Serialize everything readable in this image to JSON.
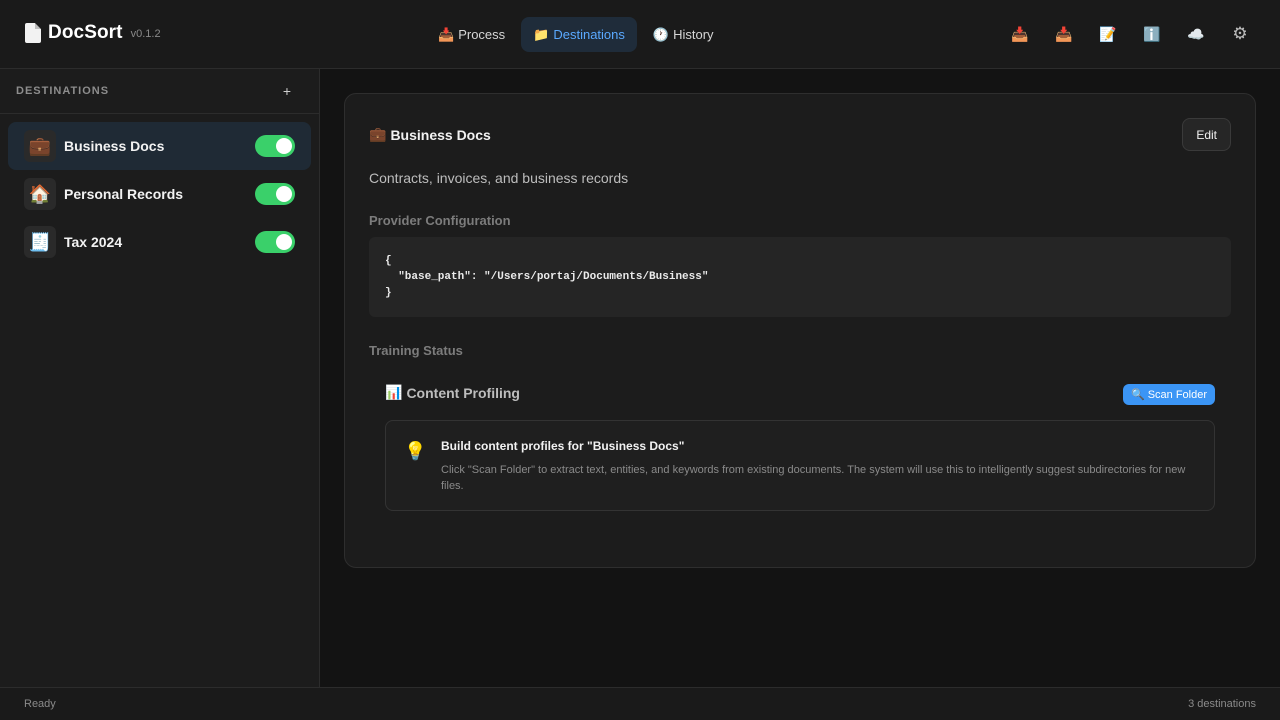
{
  "app": {
    "name": "DocSort",
    "version": "v0.1.2"
  },
  "tabs": [
    {
      "icon": "📥",
      "label": "Process"
    },
    {
      "icon": "📁",
      "label": "Destinations"
    },
    {
      "icon": "🕐",
      "label": "History"
    }
  ],
  "toolbar_icons": [
    "inbox-tray-icon",
    "inbox-tray-icon",
    "memo-icon",
    "info-icon",
    "cloud-icon",
    "gear-icon"
  ],
  "sidebar": {
    "title": "DESTINATIONS",
    "add_label": "+",
    "items": [
      {
        "icon": "💼",
        "label": "Business Docs",
        "enabled": true
      },
      {
        "icon": "🏠",
        "label": "Personal Records",
        "enabled": true
      },
      {
        "icon": "🧾",
        "label": "Tax 2024",
        "enabled": true
      }
    ]
  },
  "detail": {
    "icon": "💼",
    "title": "Business Docs",
    "edit_label": "Edit",
    "description": "Contracts, invoices, and business records",
    "provider_label": "Provider Configuration",
    "provider_config": "{\n  \"base_path\": \"/Users/portaj/Documents/Business\"\n}",
    "training_label": "Training Status",
    "profiling": {
      "icon": "📊",
      "title": "Content Profiling",
      "scan_icon": "🔍",
      "scan_label": "Scan Folder",
      "hint_icon": "💡",
      "hint_title": "Build content profiles for \"Business Docs\"",
      "hint_body": "Click \"Scan Folder\" to extract text, entities, and keywords from existing documents. The system will use this to intelligently suggest subdirectories for new files."
    }
  },
  "status": {
    "left": "Ready",
    "right": "3 destinations"
  },
  "colors": {
    "accent": "#5aa9ff",
    "toggle_on": "#3ad06a",
    "scan_button": "#3b95f5"
  }
}
